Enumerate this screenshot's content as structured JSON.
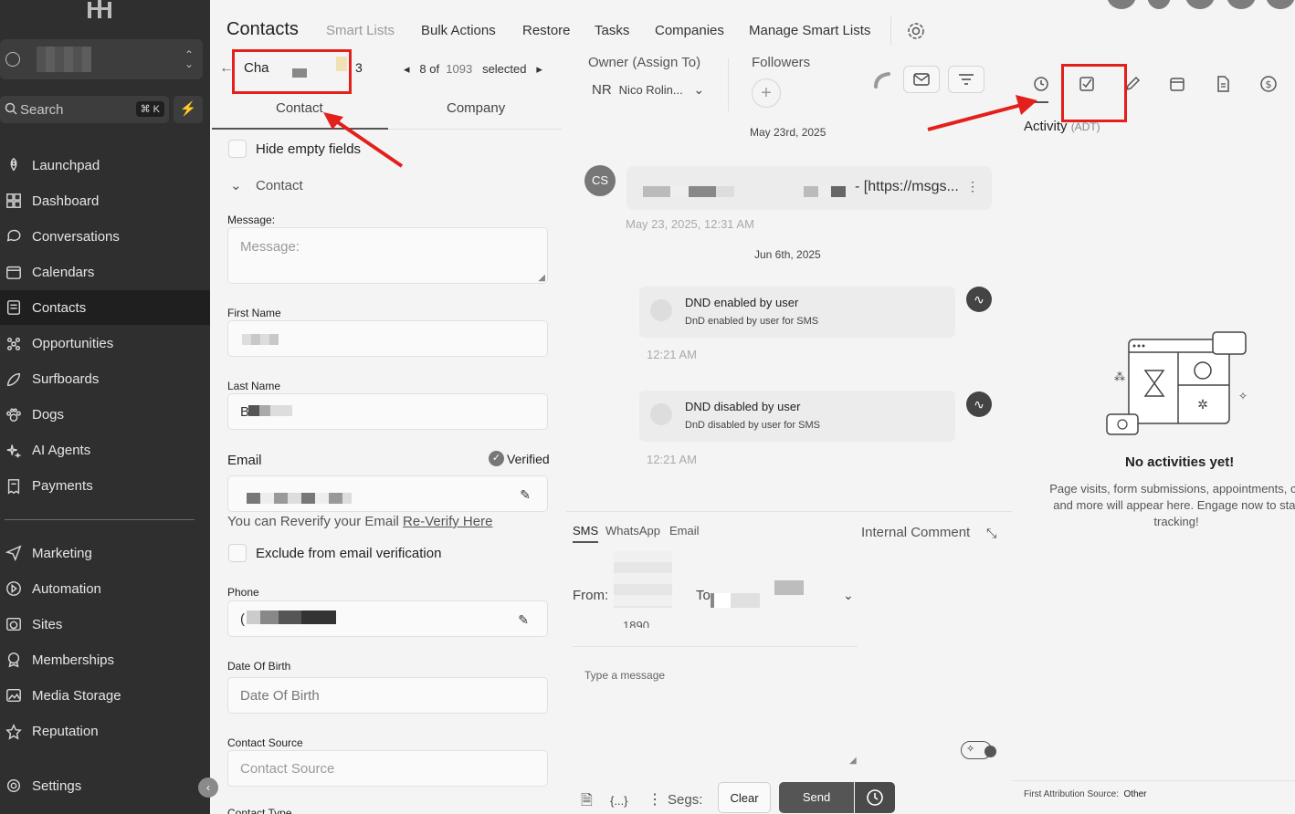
{
  "sidebar": {
    "search_label": "Search",
    "search_kbd": "⌘ K",
    "items": [
      {
        "label": "Launchpad",
        "icon": "rocket-icon"
      },
      {
        "label": "Dashboard",
        "icon": "grid-icon"
      },
      {
        "label": "Conversations",
        "icon": "chat-icon"
      },
      {
        "label": "Calendars",
        "icon": "calendar-icon"
      },
      {
        "label": "Contacts",
        "icon": "contacts-icon",
        "active": true
      },
      {
        "label": "Opportunities",
        "icon": "opportunities-icon"
      },
      {
        "label": "Surfboards",
        "icon": "surfboard-icon"
      },
      {
        "label": "Dogs",
        "icon": "paw-icon"
      },
      {
        "label": "AI Agents",
        "icon": "sparkle-icon"
      },
      {
        "label": "Payments",
        "icon": "receipt-icon"
      }
    ],
    "items2": [
      {
        "label": "Marketing",
        "icon": "send-icon"
      },
      {
        "label": "Automation",
        "icon": "automation-icon"
      },
      {
        "label": "Sites",
        "icon": "globe-icon"
      },
      {
        "label": "Memberships",
        "icon": "badge-icon"
      },
      {
        "label": "Media Storage",
        "icon": "image-icon"
      },
      {
        "label": "Reputation",
        "icon": "star-icon"
      }
    ],
    "settings_label": "Settings"
  },
  "topbar": {
    "title": "Contacts",
    "tabs": [
      "Smart Lists",
      "Bulk Actions",
      "Restore",
      "Tasks",
      "Companies",
      "Manage Smart Lists"
    ]
  },
  "contact": {
    "name_prefix": "Cha",
    "name_suffix": "3",
    "pager_index": "8 of",
    "pager_total": "1093",
    "pager_selected": "selected",
    "tabs": [
      "Contact",
      "Company"
    ],
    "hide_empty_label": "Hide empty fields",
    "section_label": "Contact",
    "message_label": "Message:",
    "message_placeholder": "Message:",
    "first_name_label": "First Name",
    "last_name_label": "Last Name",
    "last_name_partial": "B",
    "email_label": "Email",
    "verified_label": "Verified",
    "reverify_text": "You can Reverify your Email",
    "reverify_link": "Re-Verify Here",
    "exclude_label": "Exclude from email verification",
    "phone_label": "Phone",
    "phone_partial": "(",
    "dob_label": "Date Of Birth",
    "dob_placeholder": "Date Of Birth",
    "source_label": "Contact Source",
    "source_placeholder": "Contact Source",
    "type_label": "Contact Type"
  },
  "middle": {
    "owner_label": "Owner (Assign To)",
    "owner_initials": "NR",
    "owner_name": "Nico Rolin...",
    "followers_label": "Followers",
    "date1": "May 23rd, 2025",
    "cs_initials": "CS",
    "msg_text": "- [https://msgs...",
    "msg_time": "May 23, 2025, 12:31 AM",
    "date2": "Jun 6th, 2025",
    "events": [
      {
        "title": "DND enabled by user",
        "desc": "DnD enabled by user for SMS",
        "time": "12:21 AM"
      },
      {
        "title": "DND disabled by user",
        "desc": "DnD disabled by user for SMS",
        "time": "12:21 AM"
      }
    ],
    "channels": [
      "SMS",
      "WhatsApp",
      "Email"
    ],
    "internal_comment": "Internal Comment",
    "from_label": "From:",
    "to_label": "To",
    "from_partial": "1890",
    "message_placeholder": "Type a message",
    "segs_label": "Segs:",
    "clear_label": "Clear",
    "send_label": "Send"
  },
  "right": {
    "activity_label": "Activity",
    "activity_abbr": "(ADT)",
    "empty_title": "No activities yet!",
    "empty_desc": "Page visits, form submissions, appointments, ca and more will appear here. Engage now to star tracking!",
    "attribution_label": "First Attribution Source:",
    "attribution_value": "Other"
  },
  "colors": {
    "annotation_red": "#e3201b",
    "sidebar_bg": "#2f2f2f",
    "active_bg": "#1f1f1f"
  }
}
